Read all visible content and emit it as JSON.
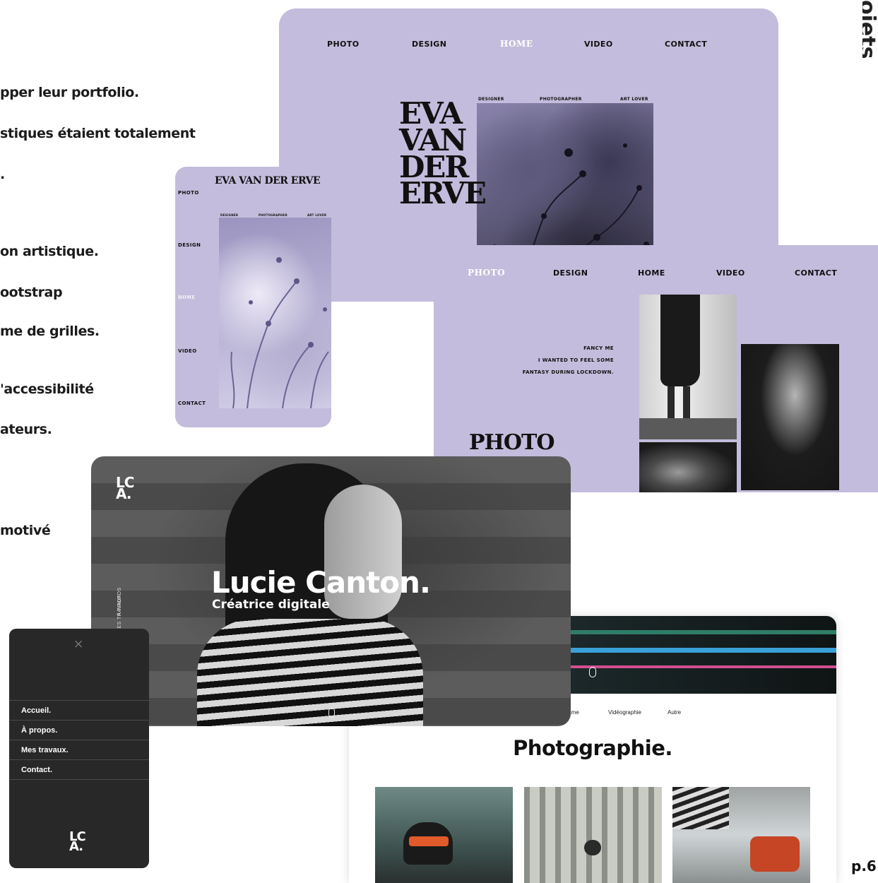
{
  "body_text": {
    "lines": [
      "pper leur portfolio.",
      "stiques étaient totalement",
      ".",
      "on artistique.",
      "ootstrap",
      "me de grilles.",
      "'accessibilité",
      "ateurs.",
      "motivé"
    ]
  },
  "side_label": "ojets",
  "page_number": "p.6",
  "eva_desktop": {
    "nav": [
      "PHOTO",
      "DESIGN",
      "HOME",
      "VIDEO",
      "CONTACT"
    ],
    "name_lines": [
      "EVA",
      "VAN",
      "DER",
      "ERVE"
    ],
    "tags": [
      "DESIGNER",
      "PHOTOGRAPHER",
      "ART LOVER"
    ]
  },
  "eva_mobile": {
    "title": "EVA VAN DER ERVE",
    "nav": [
      "PHOTO",
      "DESIGN",
      "HOME",
      "VIDEO",
      "CONTACT"
    ],
    "tags": [
      "DESIGNER",
      "PHOTOGRAPHER",
      "ART LOVER"
    ]
  },
  "eva_photo": {
    "nav": [
      "PHOTO",
      "DESIGN",
      "HOME",
      "VIDEO",
      "CONTACT"
    ],
    "caption": [
      "FANCY ME",
      "I WANTED TO FEEL SOME",
      "FANTASY DURING LOCKDOWN."
    ],
    "heading": "PHOTO"
  },
  "lucie_hero": {
    "logo": "LC\nA.",
    "side_nav": [
      "À PROPOS",
      "MES TRAVAUX"
    ],
    "name": "Lucie Canton.",
    "subtitle": "Créatrice digitale"
  },
  "lucie_gallery": {
    "filters": [
      "phisme",
      "Vidéographie",
      "Autre"
    ],
    "heading": "Photographie."
  },
  "lucie_mobile_menu": {
    "close": "×",
    "items": [
      "Accueil.",
      "À propos.",
      "Mes travaux.",
      "Contact."
    ],
    "logo": "LC\nA."
  },
  "colors": {
    "lavender": "#c4bcdc",
    "dark": "#2a2a2a"
  }
}
